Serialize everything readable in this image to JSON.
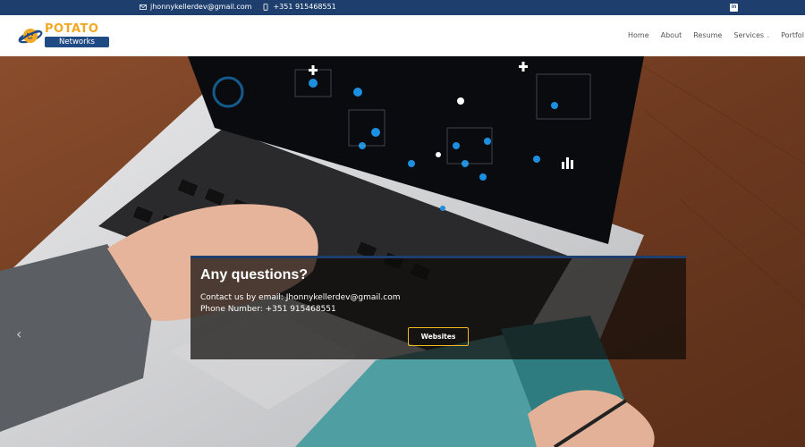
{
  "topbar": {
    "email": "jhonnykellerdev@gmail.com",
    "phone": "+351 915468551",
    "email_icon": "envelope-icon",
    "phone_icon": "mobile-phone-icon",
    "social_icon": "linkedin-icon",
    "social_label": "in"
  },
  "logo": {
    "word1": "POTATO",
    "word2": "Networks"
  },
  "nav": {
    "items": [
      "Home",
      "About",
      "Resume",
      "Services",
      "Portfol"
    ]
  },
  "hero": {
    "prev_arrow": "‹",
    "caption_title": "Any questions?",
    "caption_line1": "Contact us by email: Jhonnykellerdev@gmail.com",
    "caption_line2": "Phone Number: +351 915468551",
    "button_label": "Websites"
  },
  "colors": {
    "brand_blue": "#1e3f6e",
    "brand_orange": "#f2a825",
    "button_border": "#f2b820"
  }
}
